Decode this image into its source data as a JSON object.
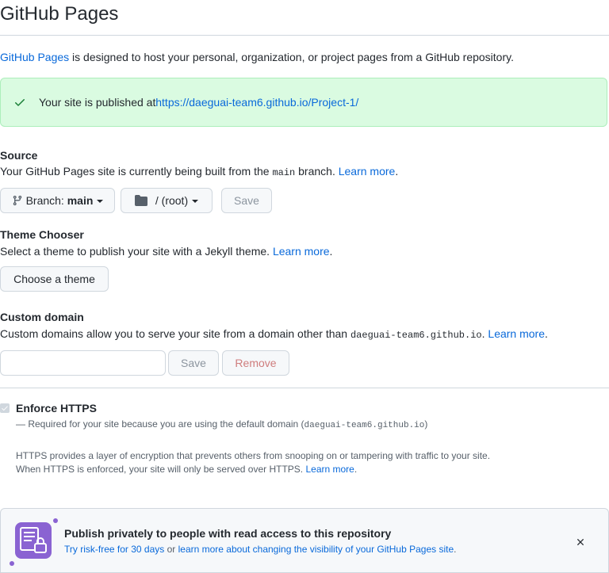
{
  "page": {
    "title": "GitHub Pages",
    "intro_link": "GitHub Pages",
    "intro_text": " is designed to host your personal, organization, or project pages from a GitHub repository."
  },
  "flash": {
    "text": "Your site is published at ",
    "url": "https://daeguai-team6.github.io/Project-1/"
  },
  "source": {
    "heading": "Source",
    "desc_before": "Your GitHub Pages site is currently being built from the ",
    "branch_code": "main",
    "desc_after": " branch. ",
    "learn_more": "Learn more",
    "period": ".",
    "branch_button_prefix": "Branch: ",
    "branch_button_value": "main",
    "folder_button": "/ (root)",
    "save_button": "Save"
  },
  "theme": {
    "heading": "Theme Chooser",
    "desc": "Select a theme to publish your site with a Jekyll theme. ",
    "learn_more": "Learn more",
    "period": ".",
    "button": "Choose a theme"
  },
  "custom_domain": {
    "heading": "Custom domain",
    "desc_before": "Custom domains allow you to serve your site from a domain other than ",
    "domain_code": "daeguai-team6.github.io",
    "desc_after": ". ",
    "learn_more": "Learn more",
    "period": ".",
    "input_value": "",
    "input_placeholder": "",
    "save_button": "Save",
    "remove_button": "Remove"
  },
  "https": {
    "label": "Enforce HTTPS",
    "checked": true,
    "required_before": "— Required for your site because you are using the default domain (",
    "required_code": "daeguai-team6.github.io",
    "required_after": ")",
    "desc_line1": "HTTPS provides a layer of encryption that prevents others from snooping on or tampering with traffic to your site.",
    "desc_line2": "When HTTPS is enforced, your site will only be served over HTTPS. ",
    "learn_more": "Learn more",
    "period": "."
  },
  "promo": {
    "title": "Publish privately to people with read access to this repository",
    "link1": "Try risk-free for 30 days",
    "middle": " or ",
    "link2": "learn more about changing the visibility of your GitHub Pages site",
    "period": "."
  },
  "colors": {
    "link": "#0969da",
    "success_bg": "#dafbe1",
    "success_icon": "#1a7f37",
    "promo_icon": "#8a63d2"
  },
  "icons": {
    "flash": "check-icon",
    "branch": "git-branch-icon",
    "folder": "folder-icon",
    "close": "x-icon",
    "promo": "lock-document-icon"
  }
}
